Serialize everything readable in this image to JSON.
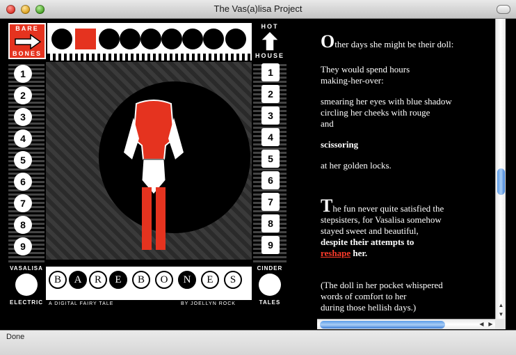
{
  "window": {
    "title": "The Vas(a)lisa Project"
  },
  "panel": {
    "top_left_top": "BARE",
    "top_left_bottom": "BONES",
    "top_right_top": "HOT",
    "top_right_bottom": "HOUSE",
    "numbers_left": [
      "1",
      "2",
      "3",
      "4",
      "5",
      "6",
      "7",
      "8",
      "9"
    ],
    "numbers_right": [
      "1",
      "2",
      "3",
      "4",
      "5",
      "6",
      "7",
      "8",
      "9"
    ],
    "bottom_left_top": "VASALISA",
    "bottom_left_bottom": "ELECTRIC",
    "bottom_right_top": "CINDER",
    "bottom_right_bottom": "TALES",
    "banner_letters": [
      "B",
      "A",
      "R",
      "E",
      "B",
      "O",
      "N",
      "E",
      "S"
    ],
    "subtitle": "A DIGITAL FAIRY TALE",
    "byline": "BY JOELLYN ROCK"
  },
  "story": {
    "p1_cap": "O",
    "p1_rest": "ther days she might be their doll:",
    "p2": "They would spend hours",
    "p2b": "making-her-over:",
    "p3": "smearing her eyes with blue shadow",
    "p3b": "circling her cheeks with rouge",
    "p3c": "and",
    "p4": "scissoring",
    "p5": "at her golden locks.",
    "p6_cap": "T",
    "p6_rest": "he fun never quite satisfied the",
    "p6b": "stepsisters, for Vasalisa somehow",
    "p6c": "stayed sweet and beautiful,",
    "p6d": "despite their attempts to",
    "p6_link": "reshape",
    "p6_after": " her.",
    "p7": "(The doll in her pocket whispered",
    "p7b": "words of comfort to her",
    "p7c": "during those hellish days.)"
  },
  "status": {
    "text": "Done"
  },
  "colors": {
    "accent": "#e5331f",
    "link": "#ff3b2a"
  }
}
